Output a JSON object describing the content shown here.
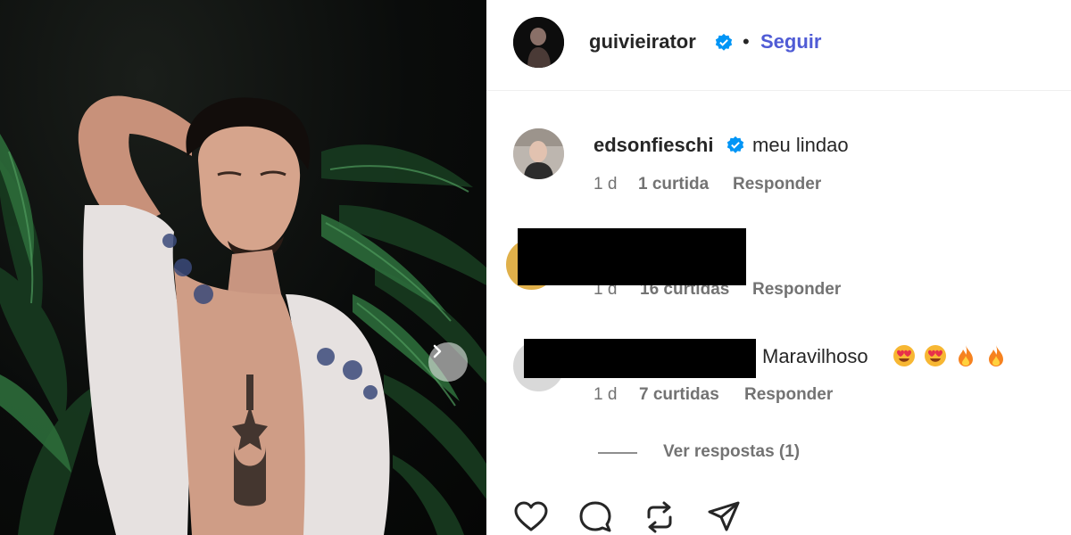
{
  "post": {
    "author": "guivieirator",
    "follow_label": "Seguir",
    "separator": "•"
  },
  "comments": [
    {
      "username": "edsonfieschi",
      "text": "meu lindao",
      "time": "1 d",
      "likes": "1 curtida",
      "reply_label": "Responder",
      "verified": true
    },
    {
      "username": "",
      "text": "",
      "time": "1 d",
      "likes": "16 curtidas",
      "reply_label": "Responder",
      "redacted": true
    },
    {
      "username": "",
      "text": "Maravilhoso",
      "emojis": [
        "smiling-heart-eyes",
        "smiling-heart-eyes",
        "fire",
        "fire"
      ],
      "time": "1 d",
      "likes": "7 curtidas",
      "reply_label": "Responder",
      "redacted": true
    }
  ],
  "view_replies_label": "Ver respostas (1)",
  "actions": [
    "heart-icon",
    "comment-icon",
    "repost-icon",
    "share-icon"
  ],
  "colors": {
    "follow": "#4f5bd5",
    "verified": "#0095f6",
    "meta": "#737373"
  }
}
